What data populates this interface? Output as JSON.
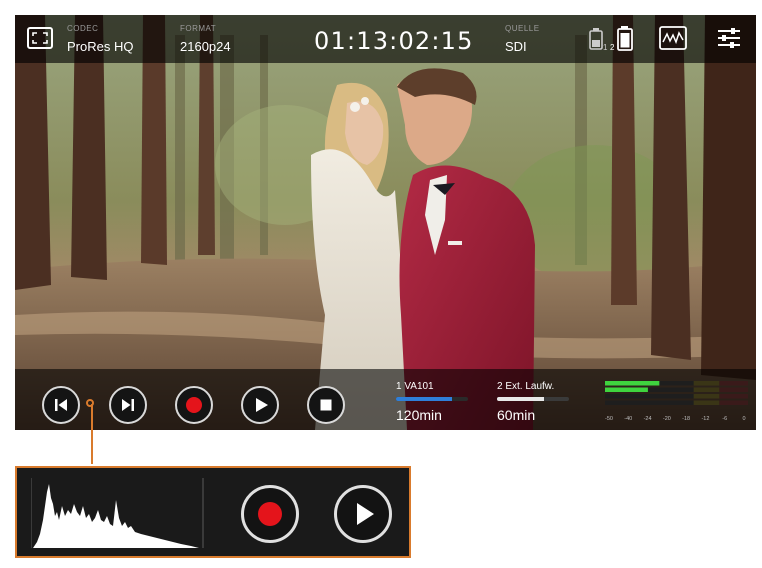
{
  "status": {
    "codec_label": "CODEC",
    "codec_value": "ProRes HQ",
    "format_label": "FORMAT",
    "format_value": "2160p24",
    "timecode": "01:13:02:15",
    "source_label": "QUELLE",
    "source_value": "SDI",
    "battery_slot_1": "1",
    "battery_slot_2": "2"
  },
  "transport": {
    "buttons": [
      "skip-back",
      "skip-forward",
      "record",
      "play",
      "stop"
    ]
  },
  "media": {
    "slot1_label": "1  VA101",
    "slot1_time": "120min",
    "slot1_fill": 0.78,
    "slot1_color": "#2f7fd9",
    "slot2_label": "2  Ext. Laufw.",
    "slot2_time": "60min",
    "slot2_fill": 0.65,
    "slot2_color": "#e8e8e8"
  },
  "audio_meters": {
    "scale": [
      "-50",
      "-40",
      "-24",
      "-20",
      "-18",
      "-12",
      "-6",
      "0"
    ],
    "levels": [
      0.38,
      0.3,
      0.0,
      0.0
    ],
    "colors": {
      "low": "#3fd43f",
      "mid": "#d6c32b",
      "high": "#d83232"
    }
  },
  "callout": {
    "buttons": [
      "record",
      "play"
    ]
  },
  "colors": {
    "accent": "#d97b2d",
    "record": "#e4141b"
  },
  "icons": [
    "screen-mode-icon",
    "battery-1-icon",
    "battery-2-icon",
    "waveform-scope-icon",
    "settings-sliders-icon"
  ]
}
